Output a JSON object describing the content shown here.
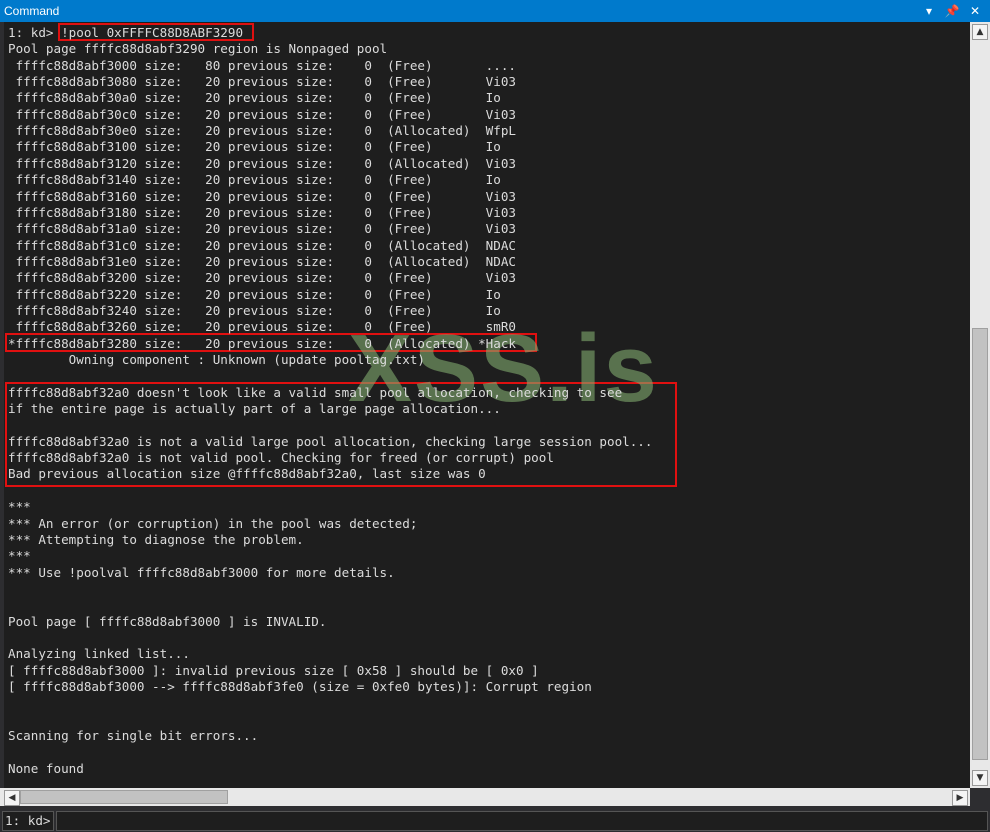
{
  "window": {
    "title": "Command"
  },
  "output": {
    "lines": [
      "1: kd> !pool 0xFFFFC88D8ABF3290",
      "Pool page ffffc88d8abf3290 region is Nonpaged pool",
      " ffffc88d8abf3000 size:   80 previous size:    0  (Free)       ....",
      " ffffc88d8abf3080 size:   20 previous size:    0  (Free)       Vi03",
      " ffffc88d8abf30a0 size:   20 previous size:    0  (Free)       Io",
      " ffffc88d8abf30c0 size:   20 previous size:    0  (Free)       Vi03",
      " ffffc88d8abf30e0 size:   20 previous size:    0  (Allocated)  WfpL",
      " ffffc88d8abf3100 size:   20 previous size:    0  (Free)       Io",
      " ffffc88d8abf3120 size:   20 previous size:    0  (Allocated)  Vi03",
      " ffffc88d8abf3140 size:   20 previous size:    0  (Free)       Io",
      " ffffc88d8abf3160 size:   20 previous size:    0  (Free)       Vi03",
      " ffffc88d8abf3180 size:   20 previous size:    0  (Free)       Vi03",
      " ffffc88d8abf31a0 size:   20 previous size:    0  (Free)       Vi03",
      " ffffc88d8abf31c0 size:   20 previous size:    0  (Allocated)  NDAC",
      " ffffc88d8abf31e0 size:   20 previous size:    0  (Allocated)  NDAC",
      " ffffc88d8abf3200 size:   20 previous size:    0  (Free)       Vi03",
      " ffffc88d8abf3220 size:   20 previous size:    0  (Free)       Io",
      " ffffc88d8abf3240 size:   20 previous size:    0  (Free)       Io",
      " ffffc88d8abf3260 size:   20 previous size:    0  (Free)       smR0",
      "*ffffc88d8abf3280 size:   20 previous size:    0  (Allocated) *Hack",
      "        Owning component : Unknown (update pooltag.txt)",
      "",
      "ffffc88d8abf32a0 doesn't look like a valid small pool allocation, checking to see",
      "if the entire page is actually part of a large page allocation...",
      "",
      "ffffc88d8abf32a0 is not a valid large pool allocation, checking large session pool...",
      "ffffc88d8abf32a0 is not valid pool. Checking for freed (or corrupt) pool",
      "Bad previous allocation size @ffffc88d8abf32a0, last size was 0",
      "",
      "***",
      "*** An error (or corruption) in the pool was detected;",
      "*** Attempting to diagnose the problem.",
      "***",
      "*** Use !poolval ffffc88d8abf3000 for more details.",
      "",
      "",
      "Pool page [ ffffc88d8abf3000 ] is INVALID.",
      "",
      "Analyzing linked list...",
      "[ ffffc88d8abf3000 ]: invalid previous size [ 0x58 ] should be [ 0x0 ]",
      "[ ffffc88d8abf3000 --> ffffc88d8abf3fe0 (size = 0xfe0 bytes)]: Corrupt region",
      "",
      "",
      "Scanning for single bit errors...",
      "",
      "None found"
    ]
  },
  "watermark": "XSS.is",
  "command_bar": {
    "prompt": "1: kd>",
    "value": ""
  },
  "icons": {
    "dropdown": "dropdown-icon",
    "pin": "pin-icon",
    "close": "close-icon",
    "scroll_up": "scroll-up-icon",
    "scroll_down": "scroll-down-icon",
    "scroll_left": "scroll-left-icon",
    "scroll_right": "scroll-right-icon"
  },
  "colors": {
    "titlebar": "#007acc",
    "highlight_box": "#e01010",
    "watermark": "#80aa6e"
  }
}
